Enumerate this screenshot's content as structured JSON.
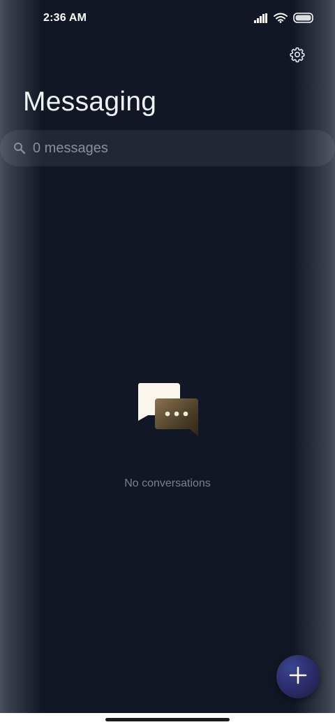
{
  "status_bar": {
    "time": "2:36 AM",
    "icons": [
      "signal-icon",
      "wifi-icon",
      "battery-icon"
    ]
  },
  "header": {
    "settings_icon": "gear-icon",
    "title": "Messaging"
  },
  "search": {
    "icon": "search-icon",
    "placeholder": "0 messages"
  },
  "empty_state": {
    "illustration": "chat-bubbles-icon",
    "text": "No conversations"
  },
  "fab": {
    "icon": "plus-icon"
  },
  "colors": {
    "background": "#121725",
    "title": "#f1f2f5",
    "muted_text": "#7b8090",
    "fab_accent": "#2b2d6b"
  }
}
